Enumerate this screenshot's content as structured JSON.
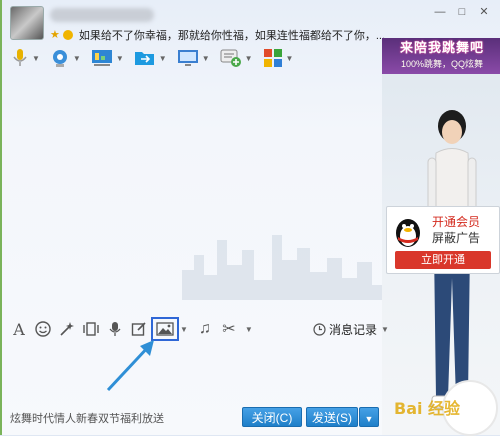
{
  "header": {
    "signature": "如果给不了你幸福，那就给你性福，如果连性福都给不了你，..."
  },
  "window_controls": {
    "minimize": "—",
    "restore": "□",
    "close": "✕"
  },
  "toolbar": {
    "items": [
      {
        "icon": "microphone-icon",
        "color": "#e8b200"
      },
      {
        "icon": "video-call-icon",
        "color": "#3a8fd9"
      },
      {
        "icon": "whiteboard-icon",
        "color": "#2e86d4"
      },
      {
        "icon": "send-file-icon",
        "color": "#1d9ae0"
      },
      {
        "icon": "remote-desktop-icon",
        "color": "#3a7fd0"
      },
      {
        "icon": "create-discussion-icon",
        "color": "#4aa84a"
      },
      {
        "icon": "apps-icon",
        "color": "#e14b2a"
      }
    ]
  },
  "ad": {
    "banner_title": "来陪我跳舞吧",
    "banner_sub": "100%跳舞，QQ炫舞",
    "vip_line1": "开通会员",
    "vip_line2": "屏蔽广告",
    "vip_button": "立即开通"
  },
  "input_toolbar": {
    "items": [
      "font-icon",
      "emoji-icon",
      "magic-expression-icon",
      "shake-icon",
      "voice-message-icon",
      "edit-icon",
      "image-icon",
      "music-icon",
      "screenshot-icon"
    ],
    "selected": "image-icon",
    "message_record": "消息记录"
  },
  "footer": {
    "promo_text": "炫舞时代情人新春双节福利放送",
    "close_button": "关闭(C)",
    "send_button": "发送(S)",
    "watermark": "Bai 经验"
  },
  "colors": {
    "accent": "#2f67d6",
    "button": "#1f7fc9",
    "vip_red": "#d9372b"
  }
}
